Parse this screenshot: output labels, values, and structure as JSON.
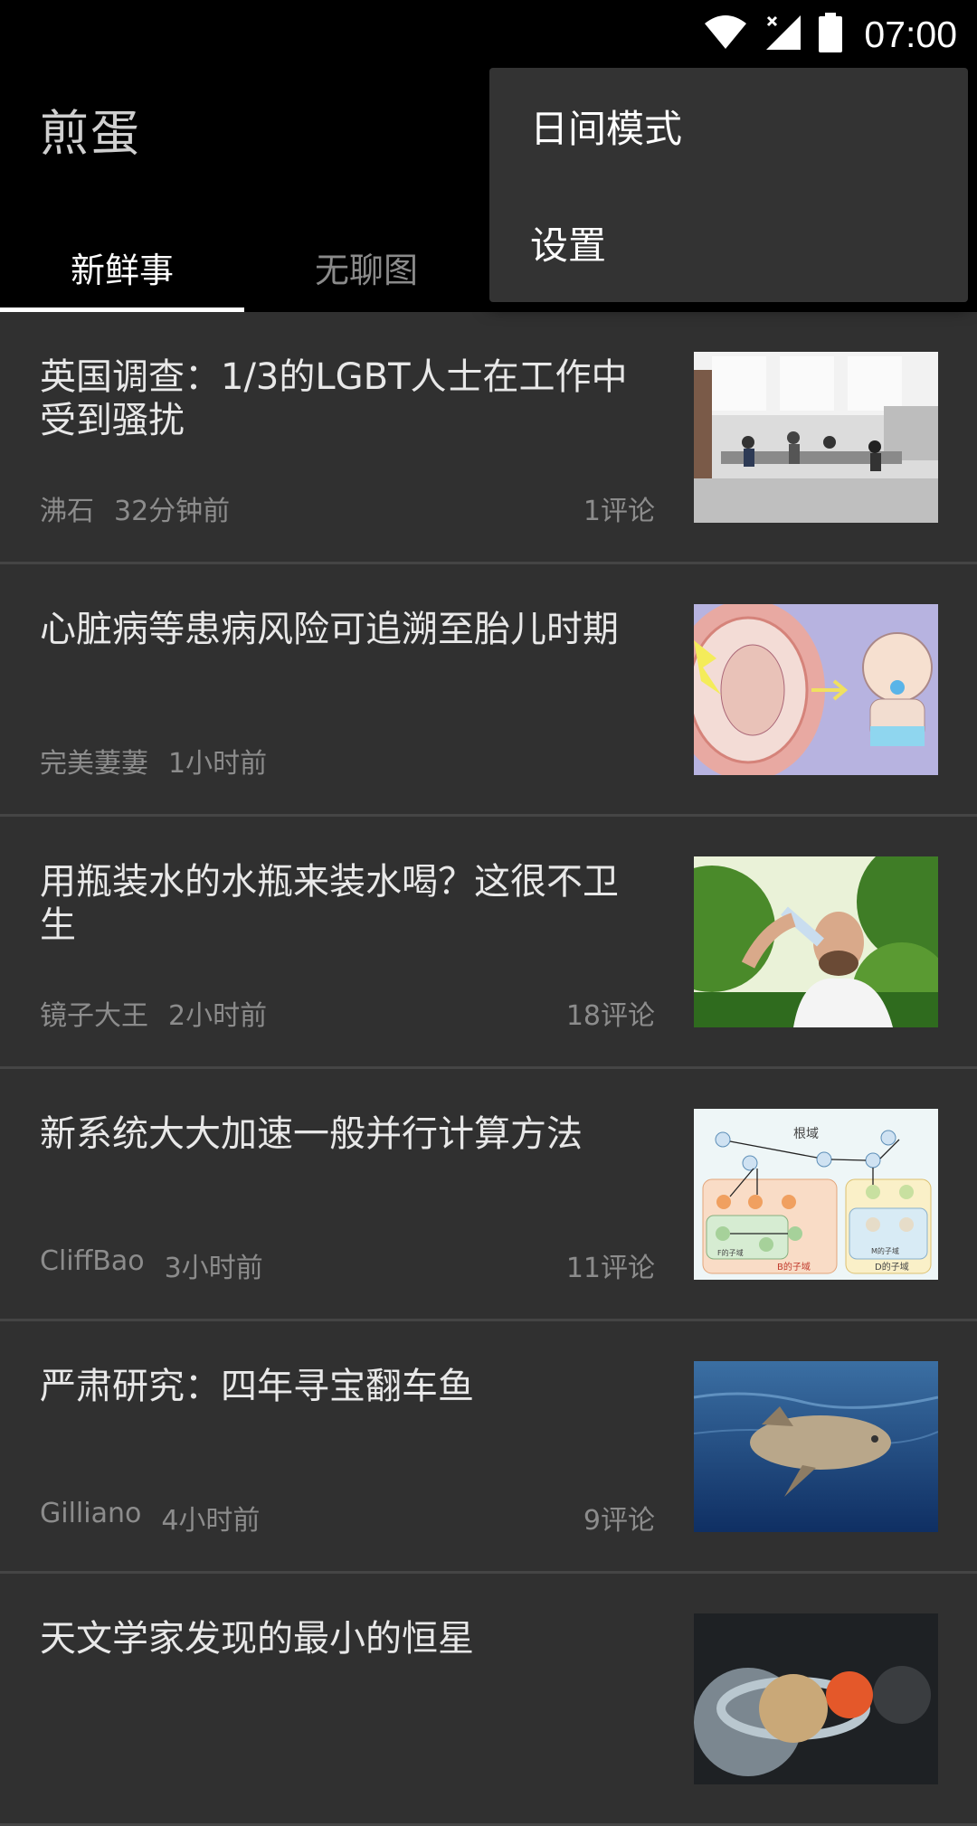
{
  "status": {
    "time": "07:00"
  },
  "app": {
    "title": "煎蛋"
  },
  "tabs": [
    {
      "label": "新鲜事"
    },
    {
      "label": "无聊图"
    }
  ],
  "menu": {
    "items": [
      {
        "label": "日间模式"
      },
      {
        "label": "设置"
      }
    ]
  },
  "feed": [
    {
      "title": "英国调查：1/3的LGBT人士在工作中受到骚扰",
      "author": "沸石",
      "time": "32分钟前",
      "comments": "1评论",
      "thumb": "office-photo"
    },
    {
      "title": "心脏病等患病风险可追溯至胎儿时期",
      "author": "完美萋萋",
      "time": "1小时前",
      "comments": "",
      "thumb": "fetus-baby-illustration"
    },
    {
      "title": "用瓶装水的水瓶来装水喝？这很不卫生",
      "author": "镜子大王",
      "time": "2小时前",
      "comments": "18评论",
      "thumb": "man-drinking-water-photo"
    },
    {
      "title": "新系统大大加速一般并行计算方法",
      "author": "CliffBao",
      "time": "3小时前",
      "comments": "11评论",
      "thumb": "domain-graph-diagram",
      "diagram_labels": [
        "根域",
        "B的子域",
        "D的子域",
        "F的子域",
        "M的子域"
      ]
    },
    {
      "title": "严肃研究：四年寻宝翻车鱼",
      "author": "Gilliano",
      "time": "4小时前",
      "comments": "9评论",
      "thumb": "sunfish-photo"
    },
    {
      "title": "天文学家发现的最小的恒星",
      "author": "",
      "time": "",
      "comments": "",
      "thumb": "planets-comparison"
    }
  ]
}
